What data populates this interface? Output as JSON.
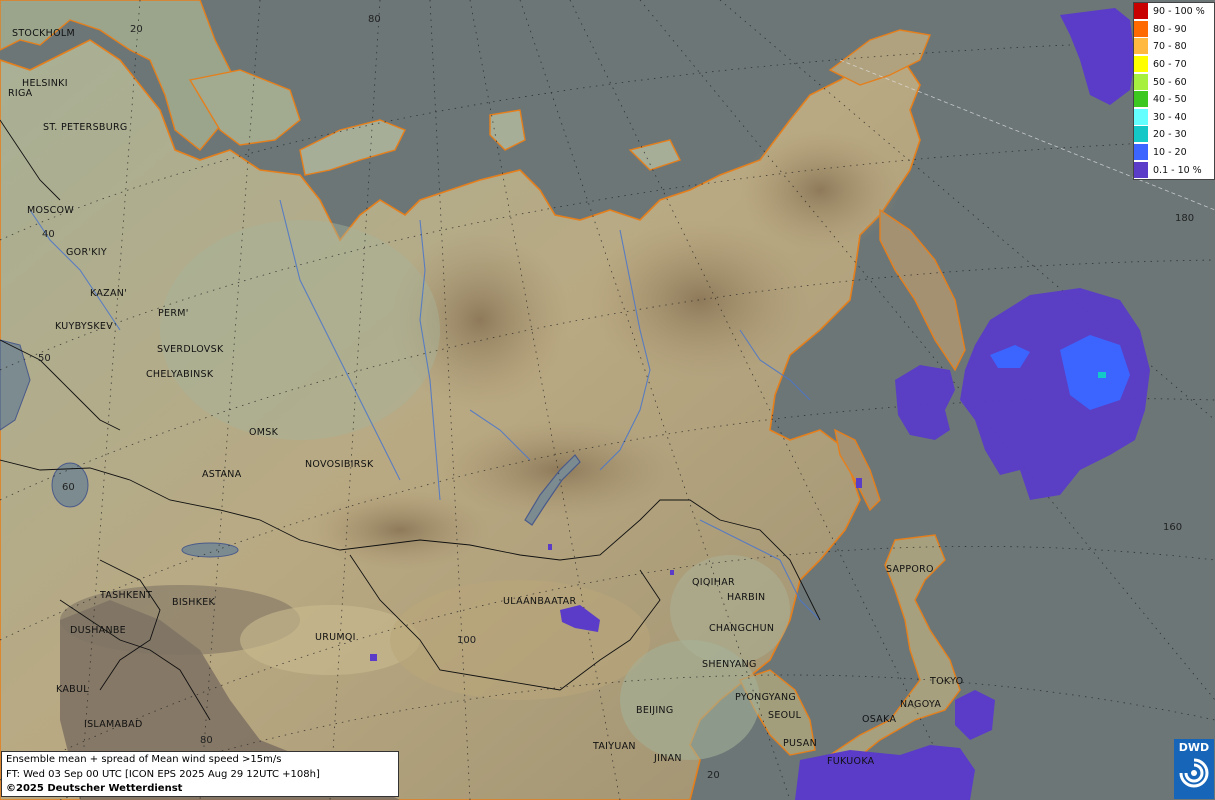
{
  "cities": [
    {
      "name": "STOCKHOLM"
    },
    {
      "name": "HELSINKI"
    },
    {
      "name": "RIGA"
    },
    {
      "name": "ST. PETERSBURG"
    },
    {
      "name": "MOSCOW"
    },
    {
      "name": "GOR'KIY"
    },
    {
      "name": "KAZAN'"
    },
    {
      "name": "PERM'"
    },
    {
      "name": "KUYBYSKEV"
    },
    {
      "name": "SVERDLOVSK"
    },
    {
      "name": "CHELYABINSK"
    },
    {
      "name": "OMSK"
    },
    {
      "name": "ASTANA"
    },
    {
      "name": "NOVOSIBIRSK"
    },
    {
      "name": "TASHKENT"
    },
    {
      "name": "BISHKEK"
    },
    {
      "name": "DUSHANBE"
    },
    {
      "name": "URUMQI"
    },
    {
      "name": "KABUL"
    },
    {
      "name": "ISLAMABAD"
    },
    {
      "name": "ULAANBAATAR"
    },
    {
      "name": "QIQIHAR"
    },
    {
      "name": "HARBIN"
    },
    {
      "name": "CHANGCHUN"
    },
    {
      "name": "SHENYANG"
    },
    {
      "name": "BEIJING"
    },
    {
      "name": "TAIYUAN"
    },
    {
      "name": "JINAN"
    },
    {
      "name": "PYONGYANG"
    },
    {
      "name": "SEOUL"
    },
    {
      "name": "PUSAN"
    },
    {
      "name": "FUKUOKA"
    },
    {
      "name": "OSAKA"
    },
    {
      "name": "NAGOYA"
    },
    {
      "name": "TOKYO"
    },
    {
      "name": "SAPPORO"
    }
  ],
  "grid_labels": [
    "20",
    "80",
    "40",
    "50",
    "60",
    "100",
    "80",
    "20",
    "160",
    "180"
  ],
  "legend": [
    {
      "label": "90 - 100 %",
      "color": "#c80000"
    },
    {
      "label": "80 - 90",
      "color": "#ff6a00"
    },
    {
      "label": "70 - 80",
      "color": "#ffb940"
    },
    {
      "label": "60 - 70",
      "color": "#ffff00"
    },
    {
      "label": "50 - 60",
      "color": "#a8f040"
    },
    {
      "label": "40 - 50",
      "color": "#3cc81e"
    },
    {
      "label": "30 - 40",
      "color": "#64ffff"
    },
    {
      "label": "20 - 30",
      "color": "#14c8c8"
    },
    {
      "label": "10 - 20",
      "color": "#3c64ff"
    },
    {
      "label": "0.1 - 10 %",
      "color": "#5a3cc8"
    }
  ],
  "info": {
    "line1": "Ensemble mean + spread of Mean wind speed >15m/s",
    "line2": "FT: Wed 03 Sep 00 UTC [ICON EPS 2025 Aug 29 12UTC +108h]",
    "copyright": "©2025 Deutscher Wetterdienst"
  },
  "logo": {
    "text": "DWD"
  }
}
